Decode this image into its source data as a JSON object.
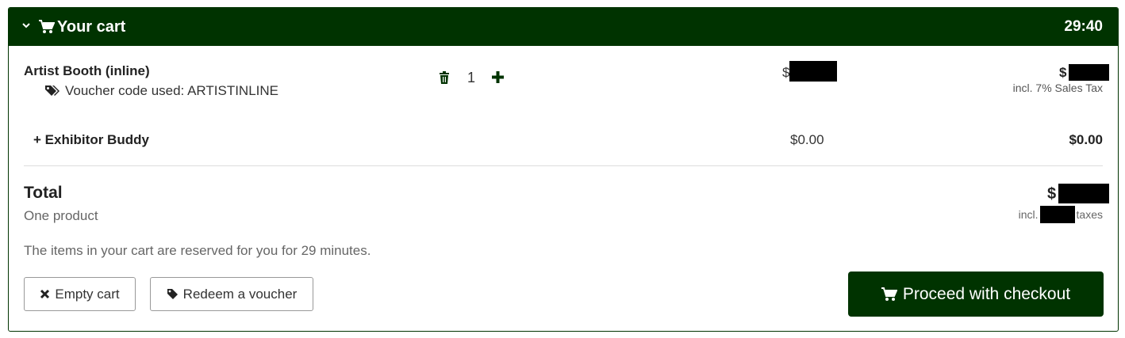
{
  "header": {
    "title": "Your cart",
    "timer": "29:40"
  },
  "items": [
    {
      "name": "Artist Booth (inline)",
      "voucher_text": "Voucher code used: ARTISTINLINE",
      "quantity": "1",
      "price_prefix": "$",
      "total_prefix": "$",
      "tax_note": "incl. 7% Sales Tax"
    },
    {
      "name": "+ Exhibitor Buddy",
      "price": "$0.00",
      "total": "$0.00"
    }
  ],
  "summary": {
    "total_label": "Total",
    "product_count": "One product",
    "total_prefix": "$",
    "incl_label": "incl.",
    "taxes_label": "taxes"
  },
  "reservation_note": "The items in your cart are reserved for you for 29 minutes.",
  "actions": {
    "empty_cart": "Empty cart",
    "redeem_voucher": "Redeem a voucher",
    "checkout": "Proceed with checkout"
  },
  "colors": {
    "brand": "#003300"
  }
}
